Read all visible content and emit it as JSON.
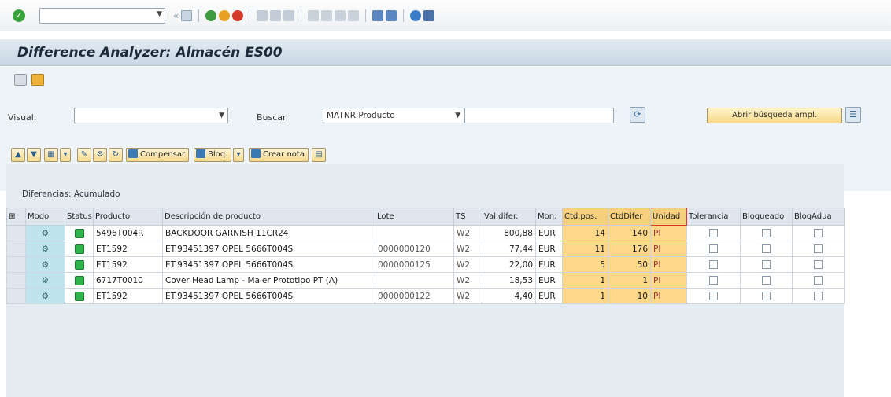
{
  "title": "Difference Analyzer: Almacén ES00",
  "search": {
    "visual_label": "Visual.",
    "visual_value": "",
    "buscar_label": "Buscar",
    "buscar_field": "MATNR Producto",
    "buscar_value": "",
    "advanced_button": "Abrir búsqueda ampl."
  },
  "toolbar": {
    "compensar": "Compensar",
    "bloq": "Bloq.",
    "crear_nota": "Crear nota"
  },
  "grid": {
    "caption": "Diferencias: Acumulado",
    "columns": [
      "Modo",
      "Status",
      "Producto",
      "Descripción de producto",
      "Lote",
      "TS",
      "Val.difer.",
      "Mon.",
      "Ctd.pos.",
      "CtdDifer",
      "Unidad",
      "Tolerancia",
      "Bloqueado",
      "BloqAdua"
    ],
    "rows": [
      {
        "producto": "5496T004R",
        "descripcion": "BACKDOOR GARNISH 11CR24",
        "lote": "",
        "ts": "W2",
        "val": "800,88",
        "mon": "EUR",
        "ctd_pos": "14",
        "ctd_dif": "140",
        "unidad": "PI"
      },
      {
        "producto": "ET1592",
        "descripcion": "ET.93451397 OPEL 5666T004S",
        "lote": "0000000120",
        "ts": "W2",
        "val": "77,44",
        "mon": "EUR",
        "ctd_pos": "11",
        "ctd_dif": "176",
        "unidad": "PI"
      },
      {
        "producto": "ET1592",
        "descripcion": "ET.93451397 OPEL 5666T004S",
        "lote": "0000000125",
        "ts": "W2",
        "val": "22,00",
        "mon": "EUR",
        "ctd_pos": "5",
        "ctd_dif": "50",
        "unidad": "PI"
      },
      {
        "producto": "6717T0010",
        "descripcion": "Cover Head Lamp - Maier Prototipo PT (A)",
        "lote": "",
        "ts": "W2",
        "val": "18,53",
        "mon": "EUR",
        "ctd_pos": "1",
        "ctd_dif": "1",
        "unidad": "PI"
      },
      {
        "producto": "ET1592",
        "descripcion": "ET.93451397 OPEL 5666T004S",
        "lote": "0000000122",
        "ts": "W2",
        "val": "4,40",
        "mon": "EUR",
        "ctd_pos": "1",
        "ctd_dif": "10",
        "unidad": "PI"
      }
    ]
  },
  "colors": {
    "status_ok": "#2fb34a",
    "highlight": "#ffd88a",
    "mode_cell": "#bfe4ee"
  }
}
